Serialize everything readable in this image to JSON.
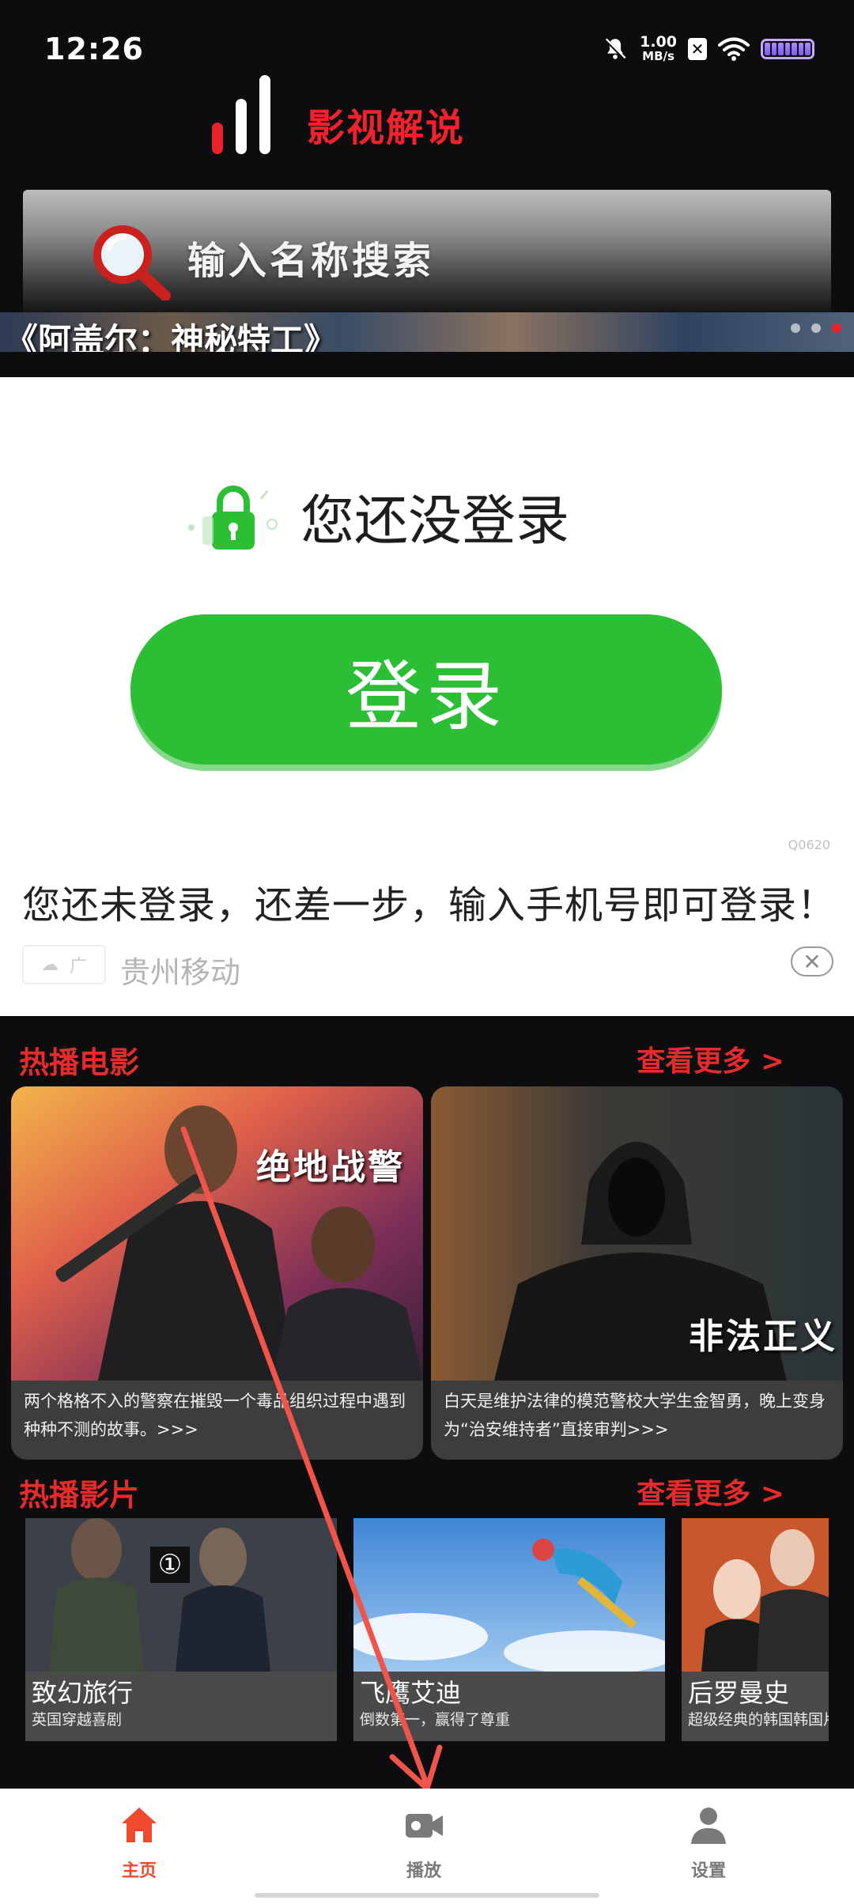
{
  "status_bar": {
    "time": "12:26",
    "speed_value": "1.00",
    "speed_unit": "MB/s",
    "x_badge": "✕"
  },
  "app": {
    "brand": "影视解说",
    "accent_color": "#e52b2b"
  },
  "search": {
    "placeholder": "输入名称搜索"
  },
  "banner": {
    "title": "《阿盖尔：神秘特工》",
    "dots": 3,
    "active_dot": 3
  },
  "ad": {
    "not_logged_text": "您还没登录",
    "login_button": "登录",
    "code": "Q0620",
    "headline": "您还未登录，还差一步，输入手机号即可登录！",
    "tag": "广",
    "advertiser": "贵州移动",
    "close": "✕"
  },
  "hot_movies": {
    "title": "热播电影",
    "more": "查看更多 >",
    "items": [
      {
        "title": "绝地战警",
        "desc": "两个格格不入的警察在摧毁一个毒品组织过程中遇到种种不测的故事。>>>"
      },
      {
        "title": "非法正义",
        "desc": "白天是维护法律的模范警校大学生金智勇，晚上变身为“治安维持者”直接审判>>>"
      }
    ]
  },
  "hot_shows": {
    "title": "热播影片",
    "more": "查看更多 >",
    "items": [
      {
        "name": "致幻旅行",
        "sub": "英国穿越喜剧",
        "badge": "①"
      },
      {
        "name": "飞鹰艾迪",
        "sub": "倒数第一，赢得了尊重"
      },
      {
        "name": "后罗曼史",
        "sub": "超级经典的韩国韩国片"
      }
    ]
  },
  "bottom_nav": [
    {
      "label": "主页",
      "icon": "home-icon",
      "active": true,
      "color": "#f04a2e"
    },
    {
      "label": "播放",
      "icon": "video-camera-icon",
      "active": false,
      "color": "#7a7a7a"
    },
    {
      "label": "设置",
      "icon": "person-icon",
      "active": false,
      "color": "#7a7a7a"
    }
  ]
}
